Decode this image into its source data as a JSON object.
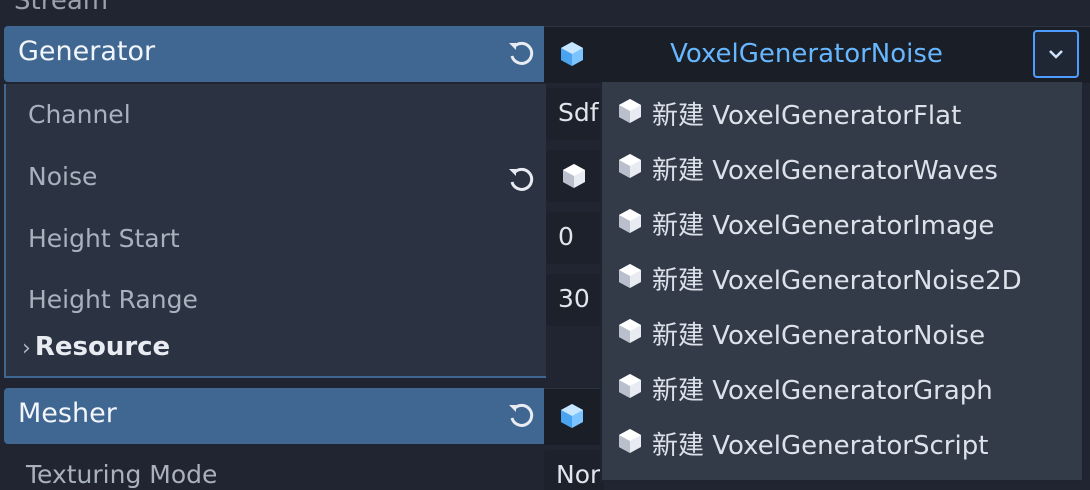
{
  "top_cut_text": "Stream",
  "generator": {
    "title": "Generator",
    "value": "VoxelGeneratorNoise",
    "properties": [
      {
        "label": "Channel",
        "value": "Sdf"
      },
      {
        "label": "Noise",
        "value": ""
      },
      {
        "label": "Height Start",
        "value": "0"
      },
      {
        "label": "Height Range",
        "value": "30"
      }
    ],
    "resource_label": "Resource"
  },
  "mesher": {
    "title": "Mesher",
    "properties": [
      {
        "label": "Texturing Mode",
        "value": "Nor"
      }
    ]
  },
  "dropdown_menu": {
    "items": [
      {
        "label": "新建 VoxelGeneratorFlat",
        "icon": "cube-icon"
      },
      {
        "label": "新建 VoxelGeneratorWaves",
        "icon": "cube-icon"
      },
      {
        "label": "新建 VoxelGeneratorImage",
        "icon": "cube-icon"
      },
      {
        "label": "新建 VoxelGeneratorNoise2D",
        "icon": "cube-icon"
      },
      {
        "label": "新建 VoxelGeneratorNoise",
        "icon": "cube-icon"
      },
      {
        "label": "新建 VoxelGeneratorGraph",
        "icon": "cube-icon"
      },
      {
        "label": "新建 VoxelGeneratorScript",
        "icon": "cube-icon"
      }
    ]
  },
  "colors": {
    "background": "#202531",
    "header": "#3f6791",
    "accent": "#67b7ff",
    "menu": "#333a48"
  }
}
